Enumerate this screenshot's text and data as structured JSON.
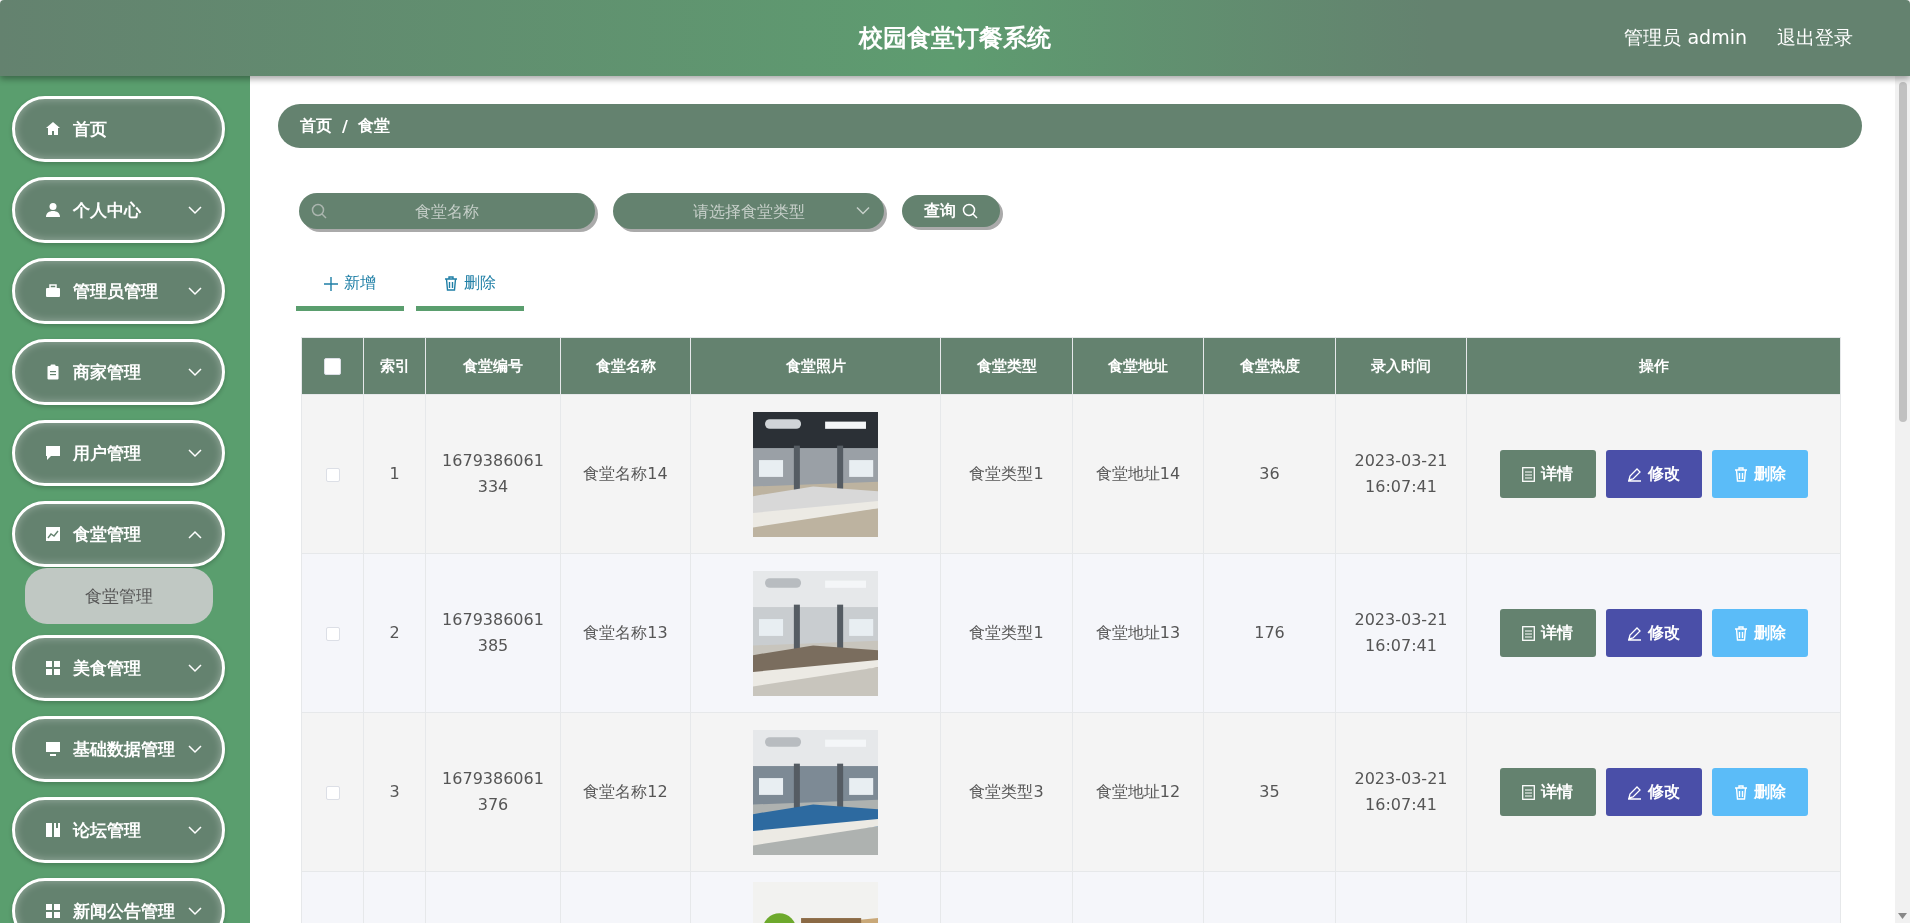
{
  "header": {
    "title": "校园食堂订餐系统",
    "user": "管理员 admin",
    "logout": "退出登录"
  },
  "sidebar": {
    "items": [
      {
        "label": "首页"
      },
      {
        "label": "个人中心",
        "expanded": false
      },
      {
        "label": "管理员管理",
        "expanded": false
      },
      {
        "label": "商家管理",
        "expanded": false
      },
      {
        "label": "用户管理",
        "expanded": false
      },
      {
        "label": "食堂管理",
        "expanded": true,
        "children": [
          {
            "label": "食堂管理",
            "selected": true
          }
        ]
      },
      {
        "label": "美食管理",
        "expanded": false
      },
      {
        "label": "基础数据管理",
        "expanded": false
      },
      {
        "label": "论坛管理",
        "expanded": false
      },
      {
        "label": "新闻公告管理",
        "expanded": false
      }
    ]
  },
  "breadcrumb": [
    "首页",
    "食堂"
  ],
  "breadcrumb_separator": "/",
  "search": {
    "name_placeholder": "食堂名称",
    "type_placeholder": "请选择食堂类型",
    "button": "查询"
  },
  "toolbar": [
    {
      "kind": "add",
      "label": "新增"
    },
    {
      "kind": "delete",
      "label": "删除"
    }
  ],
  "table": {
    "all_checked": false,
    "columns": [
      "索引",
      "食堂编号",
      "食堂名称",
      "食堂照片",
      "食堂类型",
      "食堂地址",
      "食堂热度",
      "录入时间",
      "操作"
    ],
    "rows": [
      {
        "checked": false,
        "index": "1",
        "code": "1679386061334",
        "name": "食堂名称14",
        "photo": {
          "kind": "picture"
        },
        "type": "食堂类型1",
        "address": "食堂地址14",
        "heat": "36",
        "time": "2023-03-21 16:07:41",
        "actions": [
          {
            "kind": "detail",
            "label": "详情"
          },
          {
            "kind": "edit",
            "label": "修改"
          },
          {
            "kind": "delete",
            "label": "删除"
          }
        ]
      },
      {
        "checked": false,
        "index": "2",
        "code": "1679386061385",
        "name": "食堂名称13",
        "photo": {
          "kind": "picture"
        },
        "type": "食堂类型1",
        "address": "食堂地址13",
        "heat": "176",
        "time": "2023-03-21 16:07:41",
        "actions": [
          {
            "kind": "detail",
            "label": "详情"
          },
          {
            "kind": "edit",
            "label": "修改"
          },
          {
            "kind": "delete",
            "label": "删除"
          }
        ]
      },
      {
        "checked": false,
        "index": "3",
        "code": "1679386061376",
        "name": "食堂名称12",
        "photo": {
          "kind": "picture"
        },
        "type": "食堂类型3",
        "address": "食堂地址12",
        "heat": "35",
        "time": "2023-03-21 16:07:41",
        "actions": [
          {
            "kind": "detail",
            "label": "详情"
          },
          {
            "kind": "edit",
            "label": "修改"
          },
          {
            "kind": "delete",
            "label": "删除"
          }
        ]
      },
      {
        "photo": {
          "kind": "picture"
        }
      }
    ]
  }
}
